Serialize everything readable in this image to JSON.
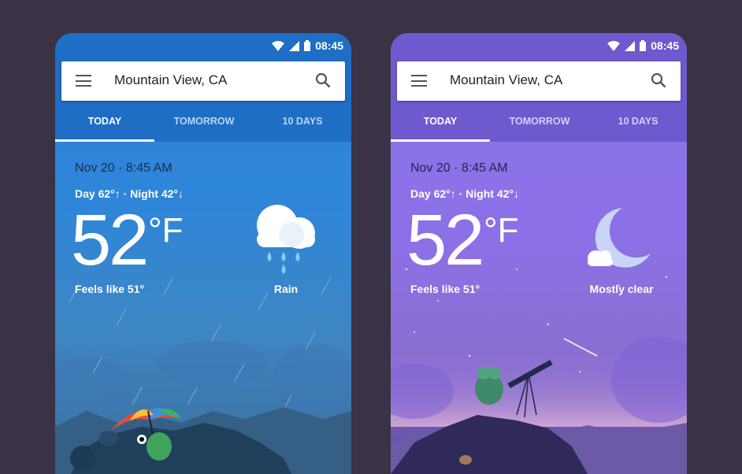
{
  "phones": [
    {
      "status": {
        "time": "08:45"
      },
      "search": {
        "location": "Mountain View, CA"
      },
      "tabs": [
        {
          "label": "TODAY"
        },
        {
          "label": "TOMORROW"
        },
        {
          "label": "10 DAYS"
        }
      ],
      "weather": {
        "date": "Nov 20 · 8:45 AM",
        "day_night": "Day 62°↑ · Night 42°↓",
        "temperature": "52",
        "unit": "°F",
        "feels_like": "Feels like 51°",
        "condition": "Rain",
        "condition_icon": "rain-cloud-icon"
      },
      "colors": {
        "appbar": "#1e6ec6",
        "sky": "#2a82dd"
      }
    },
    {
      "status": {
        "time": "08:45"
      },
      "search": {
        "location": "Mountain View, CA"
      },
      "tabs": [
        {
          "label": "TODAY"
        },
        {
          "label": "TOMORROW"
        },
        {
          "label": "10 DAYS"
        }
      ],
      "weather": {
        "date": "Nov 20 · 8:45 AM",
        "day_night": "Day 62°↑ · Night 42°↓",
        "temperature": "52",
        "unit": "°F",
        "feels_like": "Feels like 51°",
        "condition": "Mostly clear",
        "condition_icon": "moon-cloud-icon"
      },
      "colors": {
        "appbar": "#6f59cf",
        "sky": "#8a75e6"
      }
    }
  ]
}
